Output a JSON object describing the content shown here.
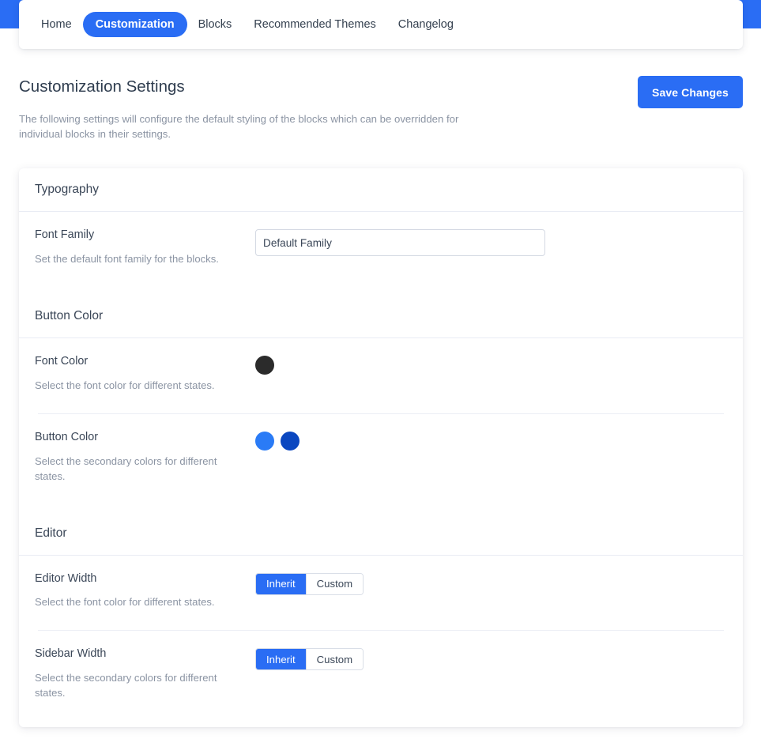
{
  "theme": {
    "brand_blue": "#2a6df4",
    "swatch_font_color": "#2b2b2b",
    "swatch_button_primary": "#2a7bf6",
    "swatch_button_secondary": "#0b47c0"
  },
  "nav": {
    "items": [
      {
        "label": "Home",
        "active": false
      },
      {
        "label": "Customization",
        "active": true
      },
      {
        "label": "Blocks",
        "active": false
      },
      {
        "label": "Recommended Themes",
        "active": false
      },
      {
        "label": "Changelog",
        "active": false
      }
    ]
  },
  "header": {
    "title": "Customization Settings",
    "description": "The following settings will configure the default styling of the blocks which can be overridden for individual blocks in their settings.",
    "save_label": "Save Changes"
  },
  "sections": {
    "typography": {
      "title": "Typography",
      "font_family": {
        "label": "Font Family",
        "description": "Set the default font family for the blocks.",
        "value": "Default Family",
        "placeholder": "Default Family"
      }
    },
    "button_color": {
      "title": "Button Color",
      "font_color": {
        "label": "Font Color",
        "description": "Select the font color for different states.",
        "swatches": [
          "#2b2b2b"
        ]
      },
      "button_color": {
        "label": "Button Color",
        "description": "Select the secondary colors for different states.",
        "swatches": [
          "#2a7bf6",
          "#0b47c0"
        ]
      }
    },
    "editor": {
      "title": "Editor",
      "editor_width": {
        "label": "Editor Width",
        "description": "Select the font color for different states.",
        "options": [
          "Inherit",
          "Custom"
        ],
        "selected": "Inherit"
      },
      "sidebar_width": {
        "label": "Sidebar Width",
        "description": "Select the secondary colors for different states.",
        "options": [
          "Inherit",
          "Custom"
        ],
        "selected": "Inherit"
      }
    }
  }
}
